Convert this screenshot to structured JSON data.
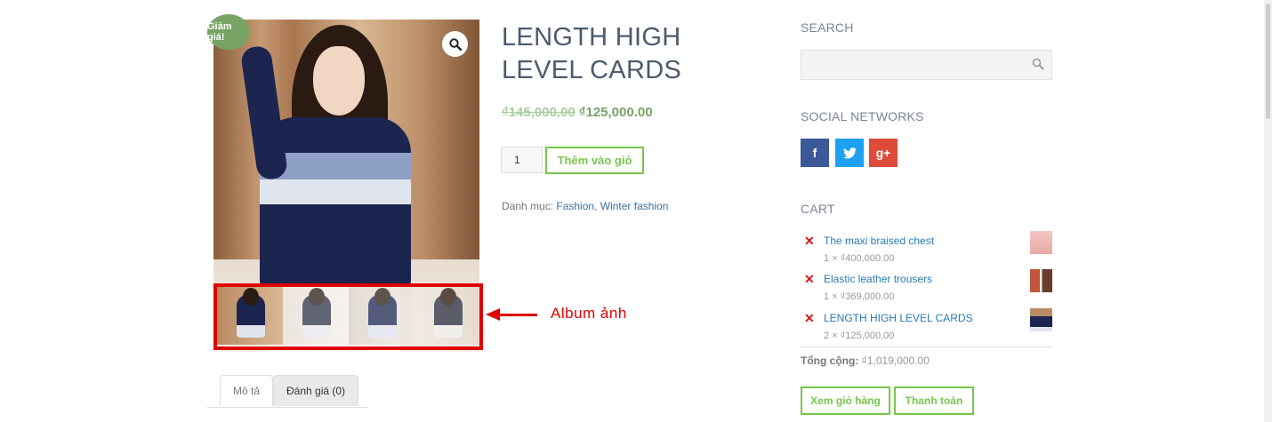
{
  "badge": {
    "sale_label": "Giảm giá!"
  },
  "annotation": {
    "album_label": "Album ảnh"
  },
  "product": {
    "title": "LENGTH HIGH LEVEL CARDS",
    "old_price": "₫145,000.00",
    "price": "₫125,000.00",
    "quantity": "1",
    "add_to_cart_label": "Thêm vào giỏ",
    "category_label": "Danh mục:",
    "categories": [
      "Fashion",
      "Winter fashion"
    ]
  },
  "tabs": [
    {
      "label": "Mô tả",
      "active": true
    },
    {
      "label": "Đánh giá (0)",
      "active": false
    }
  ],
  "sidebar": {
    "search_title": "SEARCH",
    "search_value": "",
    "social_title": "SOCIAL NETWORKS",
    "social": [
      {
        "name": "facebook",
        "glyph": "f",
        "color": "#3b5998"
      },
      {
        "name": "twitter",
        "glyph": "🐦",
        "color": "#1da1f2"
      },
      {
        "name": "google-plus",
        "glyph": "g+",
        "color": "#dd4b39"
      }
    ],
    "cart_title": "CART",
    "cart_items": [
      {
        "name": "The maxi braised chest",
        "qty_price": "1 × ₫400,000.00"
      },
      {
        "name": "Elastic leather trousers",
        "qty_price": "1 × ₫369,000.00"
      },
      {
        "name": "LENGTH HIGH LEVEL CARDS",
        "qty_price": "2 × ₫125,000.00"
      }
    ],
    "subtotal_label": "Tổng cộng:",
    "subtotal_value": "₫1,019,000.00",
    "view_cart_label": "Xem giỏ hàng",
    "checkout_label": "Thanh toán"
  },
  "colors": {
    "accent_green": "#77c74a",
    "price_green": "#77a464",
    "link_blue": "#2a7ab8",
    "annotation_red": "#e00000"
  }
}
